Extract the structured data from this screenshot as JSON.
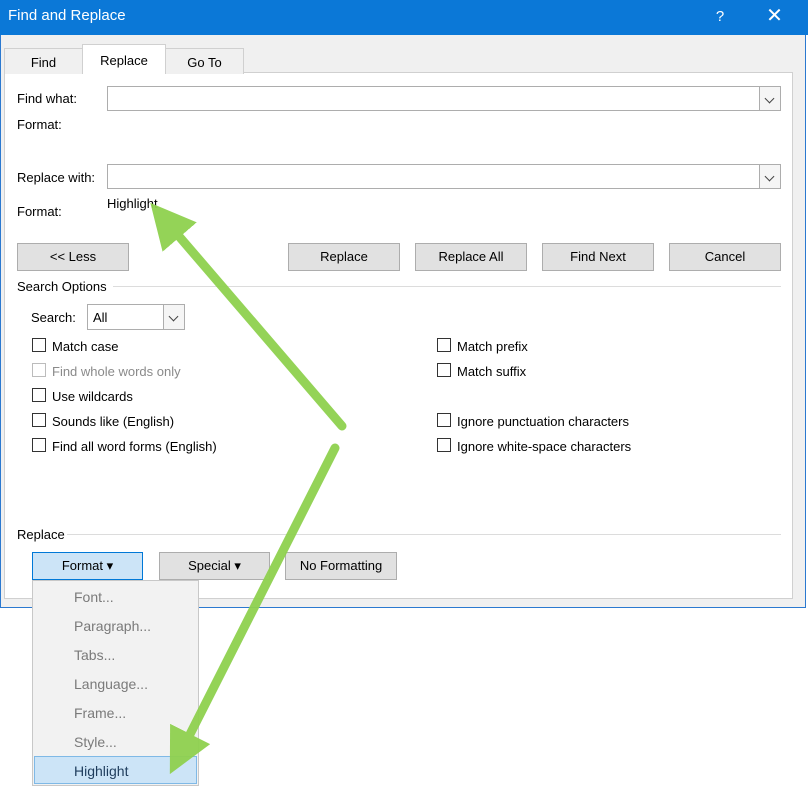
{
  "window": {
    "title": "Find and Replace",
    "help": "?",
    "close": "✕"
  },
  "tabs": {
    "find": "Find",
    "replace": "Replace",
    "goto": "Go To"
  },
  "find_what": {
    "label": "Find what:",
    "value": "",
    "format_label": "Format:",
    "format_value": ""
  },
  "replace_with": {
    "label": "Replace with:",
    "value": "",
    "format_label": "Format:",
    "format_value": "Highlight"
  },
  "buttons": {
    "less": "<< Less",
    "replace": "Replace",
    "replace_all": "Replace All",
    "find_next": "Find Next",
    "cancel": "Cancel"
  },
  "search_options": {
    "title": "Search Options",
    "search_label": "Search:",
    "search_value": "All",
    "left": [
      {
        "label": "Match case",
        "checked": false,
        "disabled": false
      },
      {
        "label": "Find whole words only",
        "checked": false,
        "disabled": true
      },
      {
        "label": "Use wildcards",
        "checked": false,
        "disabled": false
      },
      {
        "label": "Sounds like (English)",
        "checked": false,
        "disabled": false
      },
      {
        "label": "Find all word forms (English)",
        "checked": false,
        "disabled": false
      }
    ],
    "right": [
      {
        "label": "Match prefix",
        "checked": false
      },
      {
        "label": "Match suffix",
        "checked": false
      },
      {
        "label": "Ignore punctuation characters",
        "checked": false
      },
      {
        "label": "Ignore white-space characters",
        "checked": false
      }
    ]
  },
  "replace_section": {
    "title": "Replace",
    "format": "Format ▾",
    "special": "Special ▾",
    "no_formatting": "No Formatting"
  },
  "format_menu": [
    "Font...",
    "Paragraph...",
    "Tabs...",
    "Language...",
    "Frame...",
    "Style...",
    "Highlight"
  ],
  "colors": {
    "titlebar": "#0b78d7",
    "annotation_arrow": "#8fd14f",
    "menu_highlight": "#cce4f7"
  }
}
